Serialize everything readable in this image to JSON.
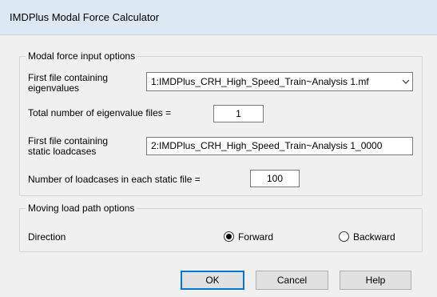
{
  "window": {
    "title": "IMDPlus Modal Force Calculator"
  },
  "modal_group": {
    "legend": "Modal force input options",
    "first_eigen_label_line1": "First file containing",
    "first_eigen_label_line2": "eigenvalues",
    "first_eigen_value": "1:IMDPlus_CRH_High_Speed_Train~Analysis 1.mf",
    "total_eigen_label": "Total number of eigenvalue files =",
    "total_eigen_value": "1",
    "first_static_label_line1": "First file containing",
    "first_static_label_line2": "static loadcases",
    "first_static_value": "2:IMDPlus_CRH_High_Speed_Train~Analysis 1_0000",
    "num_loadcases_label": "Number of loadcases in each static file =",
    "num_loadcases_value": "100"
  },
  "path_group": {
    "legend": "Moving load path options",
    "direction_label": "Direction",
    "forward_label": "Forward",
    "backward_label": "Backward",
    "selected": "Forward"
  },
  "buttons": {
    "ok": "OK",
    "cancel": "Cancel",
    "help": "Help"
  }
}
